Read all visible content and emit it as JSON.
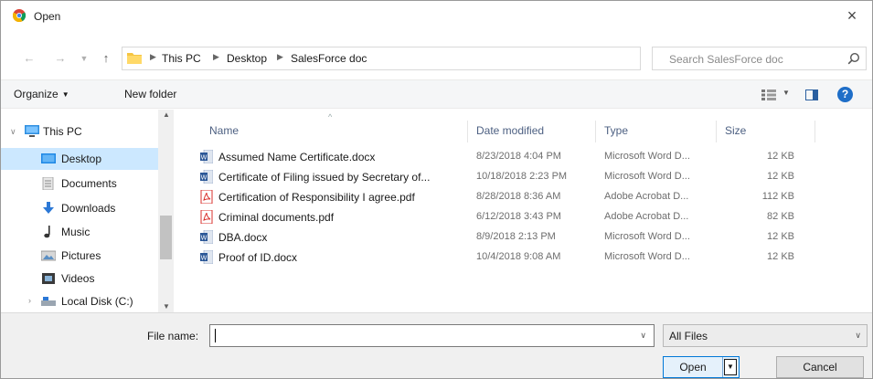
{
  "window": {
    "title": "Open",
    "close_symbol": "×"
  },
  "address": {
    "breadcrumbs": [
      "This PC",
      "Desktop",
      "SalesForce doc"
    ],
    "search_placeholder": "Search SalesForce doc"
  },
  "toolbar": {
    "organize_label": "Organize",
    "new_folder_label": "New folder",
    "help_symbol": "?"
  },
  "sidebar": {
    "items": [
      {
        "label": "This PC",
        "icon": "pc-icon"
      },
      {
        "label": "Desktop",
        "icon": "desktop-icon",
        "selected": true
      },
      {
        "label": "Documents",
        "icon": "documents-icon"
      },
      {
        "label": "Downloads",
        "icon": "downloads-icon"
      },
      {
        "label": "Music",
        "icon": "music-icon"
      },
      {
        "label": "Pictures",
        "icon": "pictures-icon"
      },
      {
        "label": "Videos",
        "icon": "videos-icon"
      },
      {
        "label": "Local Disk (C:)",
        "icon": "disk-icon"
      }
    ]
  },
  "file_list": {
    "columns": [
      "Name",
      "Date modified",
      "Type",
      "Size"
    ],
    "rows": [
      {
        "name": "Assumed Name Certificate.docx",
        "date": "8/23/2018 4:04 PM",
        "type": "Microsoft Word D...",
        "size": "12 KB",
        "icon": "word-icon"
      },
      {
        "name": "Certificate of Filing issued by Secretary of...",
        "date": "10/18/2018 2:23 PM",
        "type": "Microsoft Word D...",
        "size": "12 KB",
        "icon": "word-icon"
      },
      {
        "name": "Certification of Responsibility I agree.pdf",
        "date": "8/28/2018 8:36 AM",
        "type": "Adobe Acrobat D...",
        "size": "112 KB",
        "icon": "pdf-icon"
      },
      {
        "name": "Criminal documents.pdf",
        "date": "6/12/2018 3:43 PM",
        "type": "Adobe Acrobat D...",
        "size": "82 KB",
        "icon": "pdf-icon"
      },
      {
        "name": "DBA.docx",
        "date": "8/9/2018 2:13 PM",
        "type": "Microsoft Word D...",
        "size": "12 KB",
        "icon": "word-icon"
      },
      {
        "name": "Proof of ID.docx",
        "date": "10/4/2018 9:08 AM",
        "type": "Microsoft Word D...",
        "size": "12 KB",
        "icon": "word-icon"
      }
    ]
  },
  "bottom": {
    "file_name_label": "File name:",
    "file_name_value": "",
    "file_type_value": "All Files",
    "open_label": "Open",
    "cancel_label": "Cancel"
  },
  "colors": {
    "accent": "#0078d7",
    "selection": "#cce8ff",
    "folder": "#f5c542",
    "word": "#2b5797",
    "pdf": "#d9302c"
  }
}
